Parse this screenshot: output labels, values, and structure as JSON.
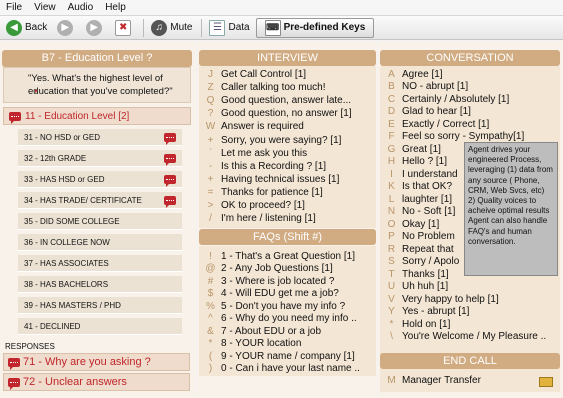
{
  "menu": [
    "File",
    "View",
    "Audio",
    "Help"
  ],
  "toolbar": {
    "back_label": "Back",
    "mute_label": "Mute",
    "data_label": "Data",
    "keys_label": "Pre-defined Keys"
  },
  "left": {
    "title": "B7 - Education Level ?",
    "question": "\"Yes. What's the highest level of education that you've  completed?\"",
    "current": "11 - Education Level [2]",
    "options": [
      {
        "label": "31 - NO HSD or GED",
        "chat": true
      },
      {
        "label": "32 - 12th GRADE",
        "chat": true
      },
      {
        "label": "33 - HAS HSD or GED",
        "chat": true
      },
      {
        "label": "34 - HAS TRADE/ CERTIFICATE",
        "chat": true
      },
      {
        "label": "35 - DID SOME COLLEGE",
        "chat": false
      },
      {
        "label": "36 - IN COLLEGE NOW",
        "chat": false
      },
      {
        "label": "37 - HAS ASSOCIATES",
        "chat": false
      },
      {
        "label": "38 - HAS BACHELORS",
        "chat": false
      },
      {
        "label": "39 - HAS MASTERS / PHD",
        "chat": false
      },
      {
        "label": "41 - DECLINED",
        "chat": false
      }
    ],
    "responses_title": "RESPONSES",
    "responses": [
      "71 - Why are you asking ?",
      "72 - Unclear answers"
    ]
  },
  "interview": {
    "title": "INTERVIEW",
    "items": [
      {
        "key": "J",
        "label": "Get Call Control [1]"
      },
      {
        "key": "Z",
        "label": "Caller talking too much!"
      },
      {
        "key": "Q",
        "label": "Good question, answer late..."
      },
      {
        "key": "?",
        "label": "Good question, no answer [1]"
      },
      {
        "key": "W",
        "label": "Answer is required"
      },
      {
        "key": "+",
        "label": "Sorry, you were saying? [1]"
      },
      {
        "key": "`",
        "label": "Let me ask you this"
      },
      {
        "key": "-",
        "label": "Is this a Recording ? [1]"
      },
      {
        "key": "+",
        "label": "Having technical issues [1]"
      },
      {
        "key": "=",
        "label": "Thanks for patience [1]"
      },
      {
        "key": ">",
        "label": "OK to proceed? [1]"
      },
      {
        "key": "/",
        "label": "I'm here / listening [1]"
      }
    ]
  },
  "faqs": {
    "title": "FAQs (Shift #)",
    "items": [
      {
        "key": "!",
        "label": "1 - That's a Great Question [1]"
      },
      {
        "key": "@",
        "label": "2 - Any Job Questions [1]"
      },
      {
        "key": "#",
        "label": "3 - Where is job located ?"
      },
      {
        "key": "$",
        "label": "4 - Will EDU get me a job?"
      },
      {
        "key": "%",
        "label": "5 - Don't you have my info ?"
      },
      {
        "key": "^",
        "label": "6 - Why do you need my info .."
      },
      {
        "key": "&",
        "label": "7 - About EDU or a job"
      },
      {
        "key": "*",
        "label": "8 - YOUR location"
      },
      {
        "key": "(",
        "label": "9 - YOUR name / company [1]"
      },
      {
        "key": ")",
        "label": "0 - Can i have your last name .."
      }
    ]
  },
  "conversation": {
    "title": "CONVERSATION",
    "items": [
      {
        "key": "A",
        "label": "Agree [1]"
      },
      {
        "key": "B",
        "label": "NO - abrupt [1]"
      },
      {
        "key": "C",
        "label": "Certainly / Absolutely [1]"
      },
      {
        "key": "D",
        "label": "Glad to hear [1]"
      },
      {
        "key": "E",
        "label": "Exactly / Correct [1]"
      },
      {
        "key": "F",
        "label": "Feel so sorry - Sympathy[1]"
      },
      {
        "key": "G",
        "label": "Great [1]"
      },
      {
        "key": "H",
        "label": "Hello ? [1]"
      },
      {
        "key": "I",
        "label": "I understand"
      },
      {
        "key": "K",
        "label": "Is that OK?"
      },
      {
        "key": "L",
        "label": "laughter [1]"
      },
      {
        "key": "N",
        "label": "No - Soft [1]"
      },
      {
        "key": "O",
        "label": "Okay [1]"
      },
      {
        "key": "P",
        "label": "No Problem"
      },
      {
        "key": "R",
        "label": "Repeat that"
      },
      {
        "key": "S",
        "label": "Sorry / Apolo"
      },
      {
        "key": "T",
        "label": "Thanks [1]"
      },
      {
        "key": "U",
        "label": "Uh huh [1]"
      },
      {
        "key": "V",
        "label": "Very happy to help [1]"
      },
      {
        "key": "Y",
        "label": "Yes - abrupt [1]"
      },
      {
        "key": "*",
        "label": "Hold on  [1]"
      },
      {
        "key": "\\",
        "label": "You're Welcome / My Pleasure .."
      }
    ]
  },
  "tooltip": "Agent drives your engineered Process, leveraging (1) data from any source ( Phone, CRM, Web Svcs, etc)\n2) Quality voices to acheive optimal results Agent can also handle FAQ's and human conversation.",
  "endcall": {
    "title": "END CALL",
    "items": [
      {
        "key": "M",
        "label": "Manager Transfer"
      }
    ]
  }
}
